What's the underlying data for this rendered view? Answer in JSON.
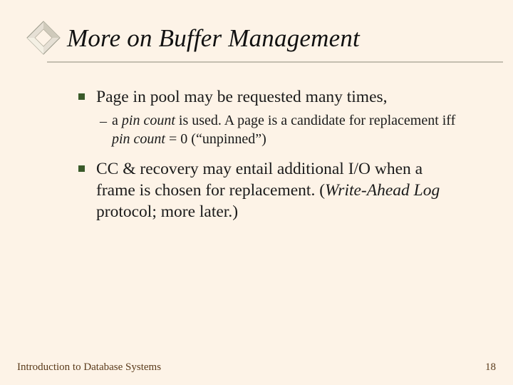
{
  "title": "More on Buffer Management",
  "bullets": {
    "b1a": "Page in pool may be requested many times,",
    "sub_pre": "a ",
    "sub_em1": "pin count",
    "sub_mid": " is used.  A page is a candidate for replacement iff ",
    "sub_em2": "pin count",
    "sub_post": " = 0 (“unpinned”)",
    "b1b_pre": "CC & recovery may entail additional I/O when a frame is chosen for replacement.  (",
    "b1b_em": "Write-Ahead Log",
    "b1b_post": " protocol; more later.)"
  },
  "footer_left": "Introduction to Database Systems",
  "footer_right": "18"
}
